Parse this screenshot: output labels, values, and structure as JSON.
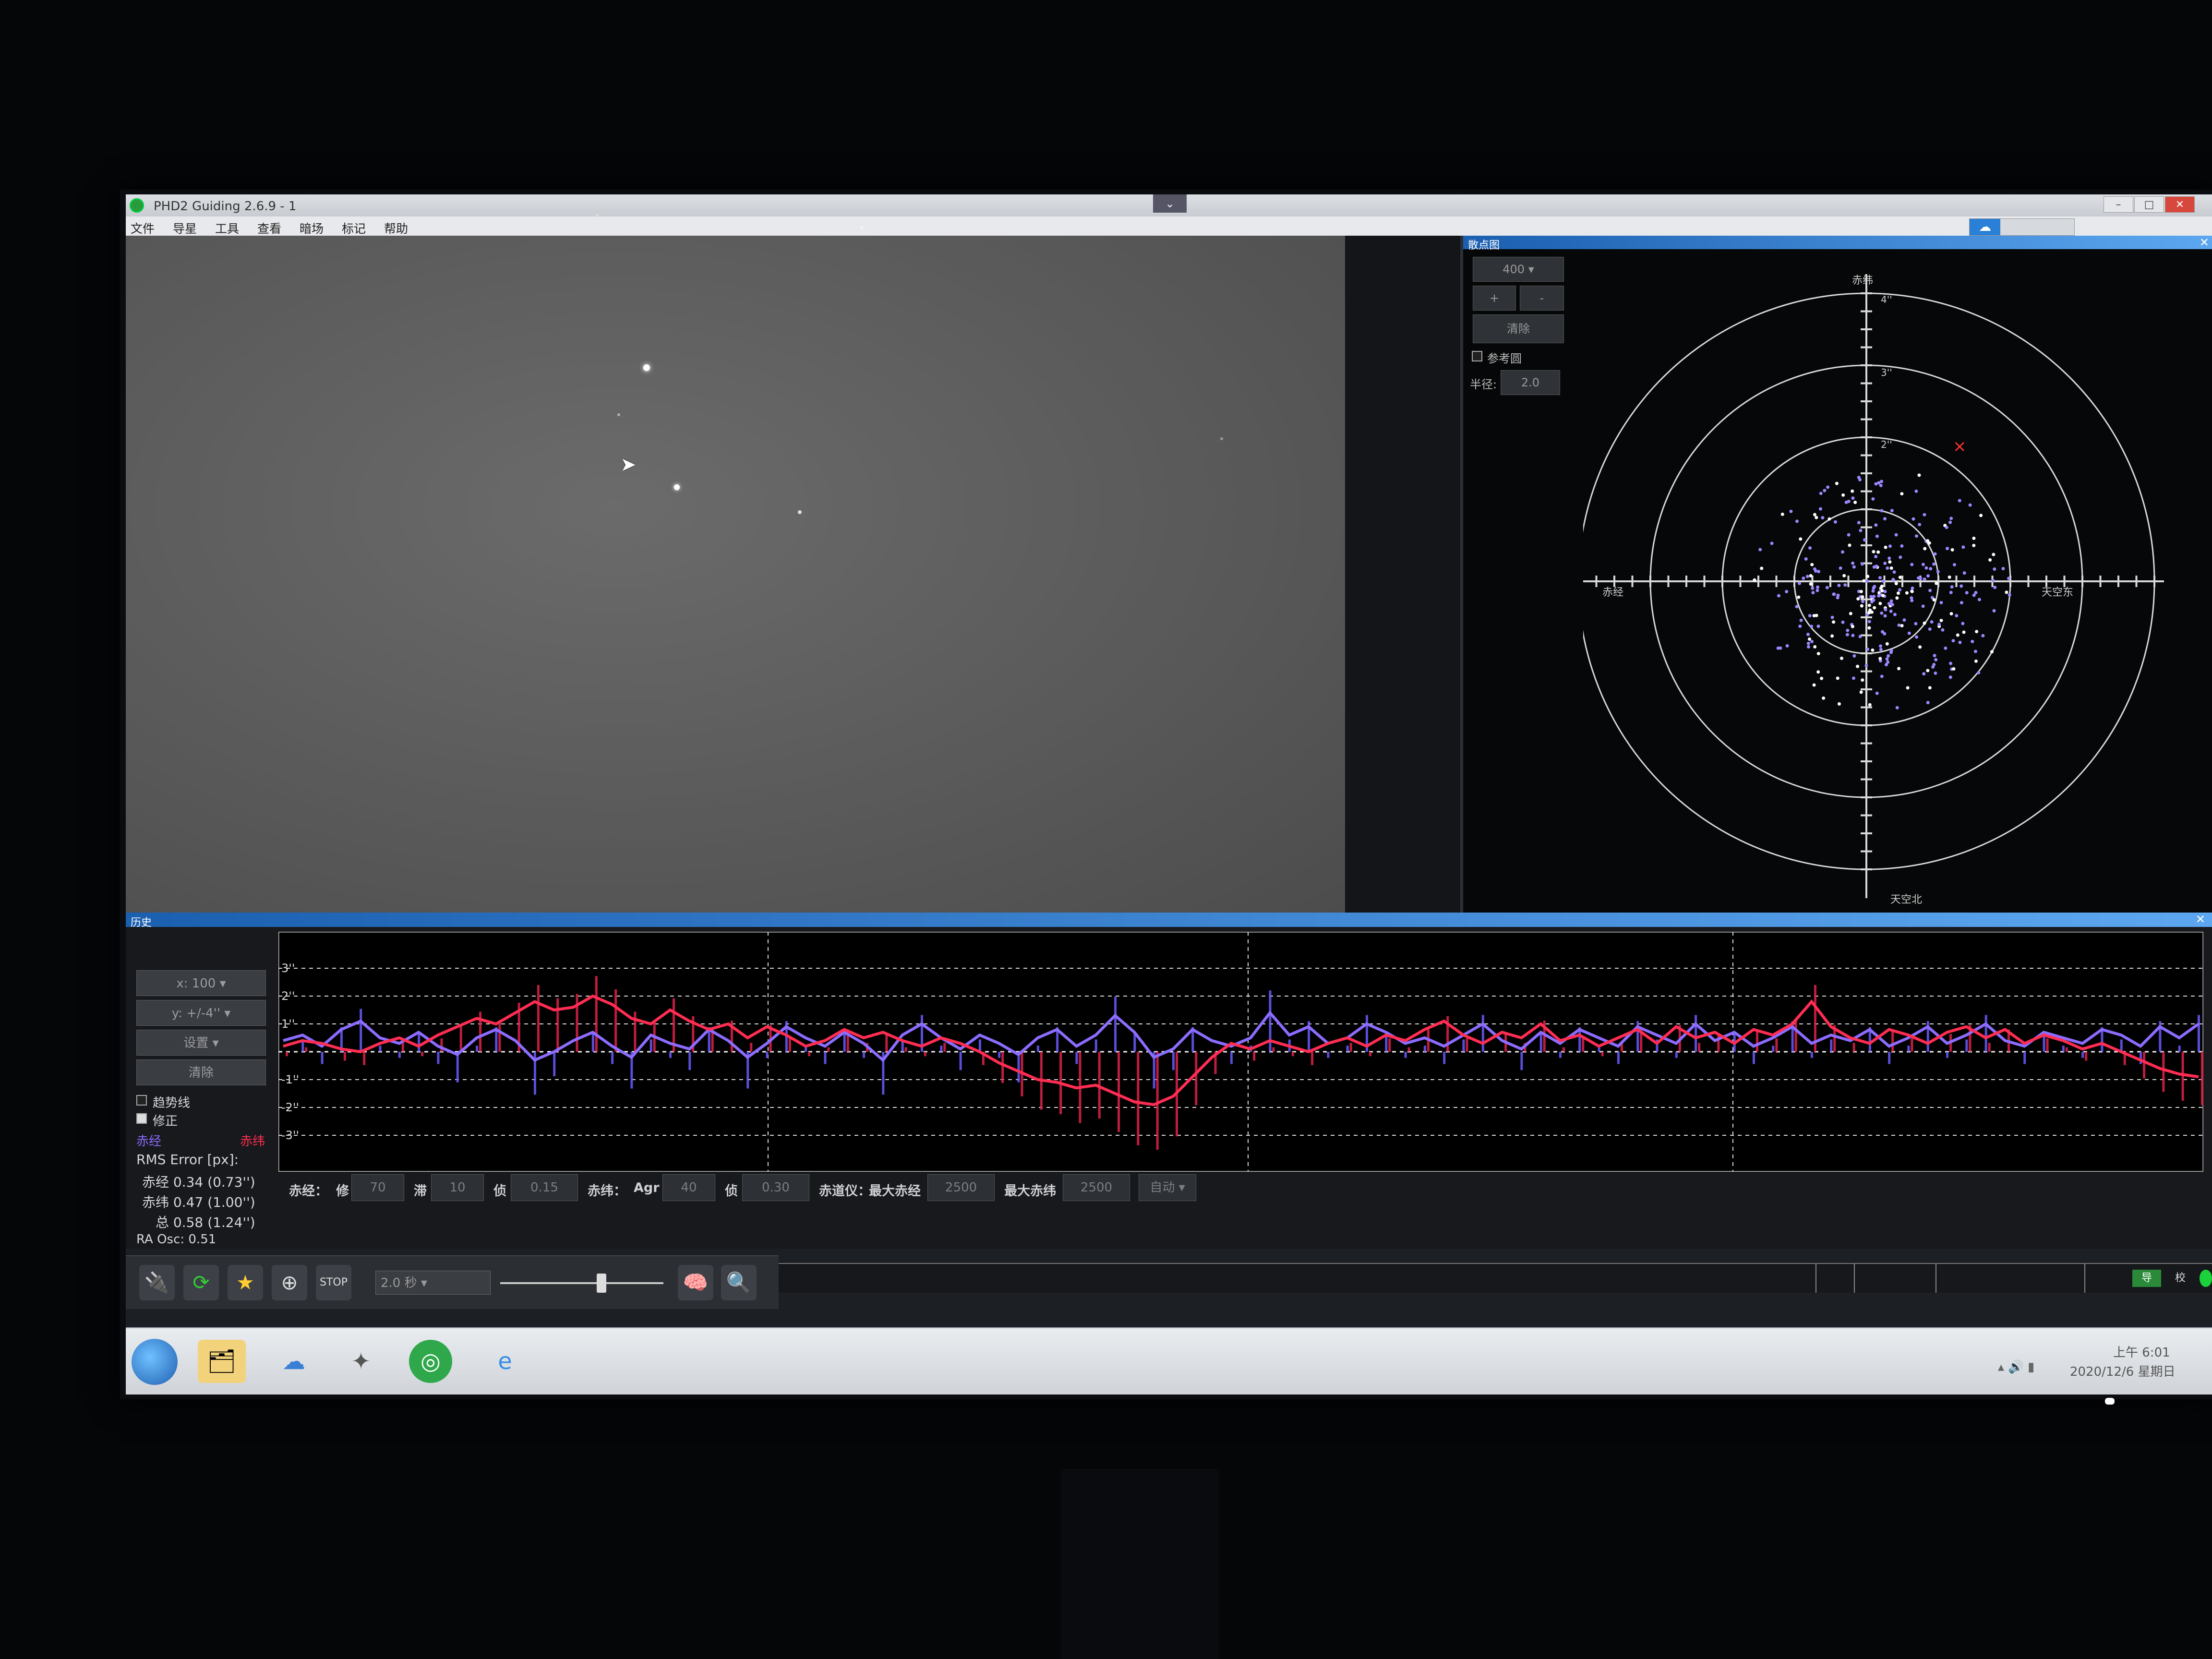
{
  "window": {
    "title": "PHD2 Guiding 2.6.9 - 1",
    "collapse_glyph": "⌄",
    "minimize_glyph": "–",
    "maximize_glyph": "□",
    "close_glyph": "✕"
  },
  "menu": [
    "文件",
    "导星",
    "工具",
    "查看",
    "暗场",
    "标记",
    "帮助"
  ],
  "cloud_icon": "cloud-sync-icon",
  "target_panel": {
    "title": "散点图",
    "close_glyph": "✕",
    "zoom_value": "400",
    "zoom_in": "+",
    "zoom_out": "-",
    "clear_label": "清除",
    "ref_circle_label": "参考圆",
    "radius_label": "半径:",
    "radius_value": "2.0",
    "axis_north": "赤纬",
    "axis_south": "天空北",
    "axis_west": "赤经",
    "axis_east": "天空东",
    "ring_labels": [
      "4''",
      "3''",
      "2''"
    ]
  },
  "history_panel": {
    "title": "历史",
    "close_glyph": "✕",
    "x_scale": "x: 100",
    "y_scale": "y: +/-4''",
    "settings_label": "设置",
    "clear_label": "清除",
    "trendlines_label": "趋势线",
    "corrections_label": "修正",
    "ra_legend": "赤经",
    "dec_legend": "赤纬",
    "rms_title": "RMS Error [px]:",
    "rms_ra": "赤经 0.34 (0.73'')",
    "rms_dec": "赤纬 0.47 (1.00'')",
    "rms_total": "总 0.58 (1.24'')",
    "ra_osc": "RA Osc: 0.51",
    "y_ticks": [
      "3''",
      "2''",
      "1''",
      "-1''",
      "-2''",
      "-3''"
    ]
  },
  "params": {
    "ra_label": "赤经：",
    "ra_agg_label": "修",
    "ra_agg_value": "70",
    "ra_hyst_label": "滞",
    "ra_hyst_value": "10",
    "ra_min_label": "侦",
    "ra_min_value": "0.15",
    "dec_label": "赤纬：",
    "dec_agr_label": "Agr",
    "dec_agr_value": "40",
    "dec_min_label": "侦",
    "dec_min_value": "0.30",
    "mount_label": "赤道仪：",
    "max_ra_label": "最大赤经",
    "max_ra_value": "2500",
    "max_dec_label": "最大赤纬",
    "max_dec_value": "2500",
    "dec_mode_value": "自动"
  },
  "toolbar": {
    "exposure_value": "2.0 秒",
    "gamma_level": 0.62,
    "stop_label": "STOP"
  },
  "status": {
    "badge_guiding": "导",
    "badge_cal": "校"
  },
  "taskbar": {
    "time": "上午 6:01",
    "date": "2020/12/6 星期日"
  },
  "colors": {
    "ra": "#8c6cff",
    "dec": "#ff2d52",
    "grid": "#d8d8d8",
    "titlebar_blue": "#2a74cc"
  },
  "chart_data": {
    "type": "line",
    "y_unit": "arcsec",
    "ylim": [
      -4,
      4
    ],
    "x_count": 100,
    "series": [
      {
        "name": "赤经",
        "values": [
          0.4,
          0.6,
          0.2,
          0.8,
          1.1,
          0.5,
          0.3,
          0.7,
          0.2,
          -0.1,
          0.5,
          0.8,
          0.4,
          -0.3,
          0.0,
          0.4,
          0.7,
          0.2,
          -0.2,
          0.6,
          0.3,
          0.1,
          0.8,
          0.4,
          -0.2,
          0.3,
          0.9,
          0.5,
          0.2,
          0.7,
          0.3,
          -0.3,
          0.6,
          1.0,
          0.5,
          0.1,
          0.6,
          0.3,
          -0.1,
          0.5,
          0.8,
          0.2,
          0.6,
          1.3,
          0.7,
          -0.2,
          0.1,
          0.8,
          0.4,
          0.2,
          0.5,
          1.4,
          0.6,
          0.9,
          0.3,
          0.5,
          1.0,
          0.7,
          0.3,
          0.5,
          0.2,
          0.6,
          1.0,
          0.4,
          0.1,
          0.7,
          0.3,
          0.8,
          0.5,
          0.2,
          0.9,
          0.6,
          0.3,
          1.0,
          0.4,
          0.7,
          0.2,
          0.5,
          0.9,
          0.3,
          0.6,
          0.4,
          0.8,
          0.2,
          0.5,
          0.9,
          0.3,
          0.6,
          1.0,
          0.4,
          0.2,
          0.7,
          0.5,
          0.3,
          0.8,
          0.6,
          0.2,
          0.9,
          0.5,
          1.0
        ]
      },
      {
        "name": "赤纬",
        "values": [
          0.2,
          0.4,
          0.3,
          0.1,
          0.0,
          0.3,
          0.5,
          0.2,
          0.6,
          0.9,
          1.2,
          1.0,
          1.4,
          1.8,
          1.5,
          1.6,
          2.0,
          1.7,
          1.2,
          1.0,
          1.5,
          1.1,
          0.8,
          1.0,
          0.5,
          0.9,
          0.6,
          0.2,
          0.4,
          0.8,
          0.5,
          0.7,
          0.4,
          0.2,
          0.5,
          0.3,
          0.0,
          -0.4,
          -0.7,
          -1.0,
          -1.1,
          -1.3,
          -1.2,
          -1.5,
          -1.8,
          -1.9,
          -1.6,
          -0.9,
          -0.2,
          0.3,
          0.1,
          0.4,
          0.2,
          0.0,
          0.3,
          0.5,
          0.2,
          0.6,
          0.4,
          0.8,
          1.1,
          0.6,
          0.3,
          0.7,
          0.5,
          1.0,
          0.4,
          0.6,
          0.2,
          0.5,
          0.8,
          0.3,
          0.9,
          0.5,
          0.7,
          0.3,
          0.8,
          0.6,
          1.0,
          1.8,
          0.9,
          0.5,
          0.3,
          0.8,
          0.6,
          0.3,
          0.7,
          0.9,
          0.5,
          0.8,
          0.3,
          0.6,
          0.4,
          0.1,
          0.3,
          0.0,
          -0.3,
          -0.6,
          -0.8,
          -0.9
        ]
      }
    ]
  }
}
